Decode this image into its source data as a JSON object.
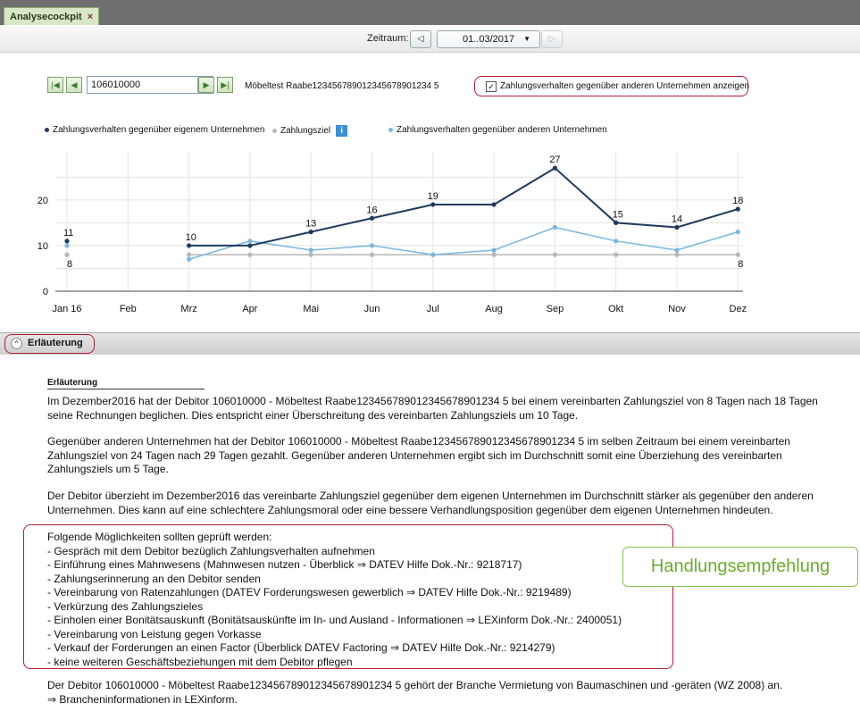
{
  "tab": {
    "title": "Analysecockpit",
    "close": "×"
  },
  "zeitraum": {
    "label": "Zeitraum:",
    "value": "01..03/2017",
    "prev": "◁",
    "next": "▷"
  },
  "debitor": {
    "number": "106010000",
    "name": "Möbeltest Raabe123456789012345678901234 5",
    "checkbox_checked": true,
    "checkbox_label": "Zahlungsverhalten gegenüber anderen Unternehmen anzeigen"
  },
  "legend": {
    "own": "Zahlungsverhalten gegenüber eigenem Unternehmen",
    "target": "Zahlungsziel",
    "other": "Zahlungsverhalten gegenüber anderen Unternehmen"
  },
  "colors": {
    "own": "#1f3a5f",
    "target": "#b8b8b8",
    "other": "#7ab7e2",
    "accent": "#b01e34",
    "green": "#6aae2a"
  },
  "chart_data": {
    "type": "line",
    "categories": [
      "Jan 16",
      "Feb",
      "Mrz",
      "Apr",
      "Mai",
      "Jun",
      "Jul",
      "Aug",
      "Sep",
      "Okt",
      "Nov",
      "Dez"
    ],
    "yticks": [
      0,
      10,
      20
    ],
    "ylim": [
      0,
      28
    ],
    "series": [
      {
        "name": "Zahlungsverhalten gegenüber eigenem Unternehmen",
        "values": [
          11,
          null,
          10,
          10,
          13,
          16,
          19,
          19,
          27,
          15,
          14,
          18
        ],
        "labels": [
          "11",
          "",
          "10",
          "",
          "13",
          "16",
          "19",
          "",
          "27",
          "15",
          "14",
          "18"
        ]
      },
      {
        "name": "Zahlungsziel",
        "values": [
          8,
          null,
          8,
          8,
          8,
          8,
          8,
          8,
          8,
          8,
          8,
          8
        ],
        "labels": [
          "8",
          "",
          "",
          "",
          "",
          "",
          "",
          "",
          "",
          "",
          "",
          "8"
        ]
      },
      {
        "name": "Zahlungsverhalten gegenüber anderen Unternehmen",
        "values": [
          10,
          null,
          7,
          11,
          9,
          10,
          8,
          9,
          14,
          11,
          9,
          13
        ],
        "labels": [
          "",
          "",
          "",
          "",
          "",
          "",
          "",
          "",
          "",
          "",
          "",
          ""
        ]
      }
    ]
  },
  "section": {
    "title": "Erläuterung"
  },
  "explanation": {
    "heading": "Erläuterung",
    "p1_l1": "Im Dezember2016 hat der Debitor 106010000 - Möbeltest Raabe123456789012345678901234 5 bei einem vereinbarten Zahlungsziel von 8 Tagen nach 18 Tagen",
    "p1_l2": "seine Rechnungen beglichen. Dies entspricht einer Überschreitung des vereinbarten Zahlungsziels um 10 Tage.",
    "p2_l1": "Gegenüber anderen Unternehmen hat der Debitor 106010000 - Möbeltest Raabe123456789012345678901234 5 im selben Zeitraum bei einem vereinbarten",
    "p2_l2": "Zahlungsziel von 24 Tagen nach 29 Tagen gezahlt. Gegenüber anderen Unternehmen ergibt sich im Durchschnitt somit eine Überziehung des vereinbarten",
    "p2_l3": "Zahlungsziels um 5 Tage.",
    "p3_l1": "Der Debitor überzieht im Dezember2016 das vereinbarte Zahlungsziel gegenüber dem eigenen Unternehmen im Durchschnitt stärker als gegenüber den anderen",
    "p3_l2": "Unternehmen. Dies kann auf eine schlechtere Zahlungsmoral oder eine bessere Verhandlungsposition gegenüber dem eigenen Unternehmen hindeuten.",
    "options_intro": "Folgende Möglichkeiten sollten geprüft werden:",
    "options": [
      "- Gespräch mit dem Debitor bezüglich Zahlungsverhalten aufnehmen",
      "- Einführung eines Mahnwesens (Mahnwesen nutzen - Überblick  ⇒ DATEV Hilfe Dok.-Nr.: 9218717)",
      "- Zahlungserinnerung an den Debitor senden",
      "- Vereinbarung von Ratenzahlungen (DATEV Forderungswesen gewerblich  ⇒ DATEV Hilfe Dok.-Nr.: 9219489)",
      "- Verkürzung des Zahlungszieles",
      "- Einholen einer Bonitätsauskunft (Bonitätsauskünfte im In- und Ausland - Informationen  ⇒ LEXinform Dok.-Nr.: 2400051)",
      "- Vereinbarung von Leistung gegen Vorkasse",
      "- Verkauf der Forderungen an einen Factor (Überblick DATEV Factoring  ⇒ DATEV Hilfe Dok.-Nr.: 9214279)",
      "- keine weiteren Geschäftsbeziehungen mit dem Debitor pflegen"
    ],
    "p4_l1": "Der Debitor 106010000 - Möbeltest Raabe123456789012345678901234 5 gehört der Branche Vermietung von Baumaschinen und -geräten (WZ 2008) an.",
    "p4_l2": "⇒ Brancheninformationen in LEXinform."
  },
  "callout": "Handlungsempfehlung"
}
